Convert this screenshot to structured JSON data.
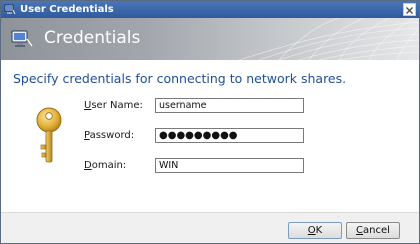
{
  "window": {
    "title": "User Credentials",
    "title_icon": "network-computer-icon",
    "close_icon": "close-icon"
  },
  "banner": {
    "title": "Credentials",
    "icon": "network-computer-icon"
  },
  "heading": "Specify credentials for connecting to network shares.",
  "form": {
    "username": {
      "label_accel": "U",
      "label_rest": "ser Name:",
      "value": "username"
    },
    "password": {
      "label_accel": "P",
      "label_rest": "assword:",
      "value": "●●●●●●●●●"
    },
    "domain": {
      "label_accel": "D",
      "label_rest": "omain:",
      "value": "WIN"
    }
  },
  "buttons": {
    "ok": {
      "accel": "O",
      "rest": "K"
    },
    "cancel": {
      "accel": "C",
      "rest": "ancel"
    }
  },
  "colors": {
    "heading": "#1f4f99",
    "titlebar": "#2f5a9e",
    "key": "#e0b23a"
  },
  "decor_icon": "key-icon"
}
